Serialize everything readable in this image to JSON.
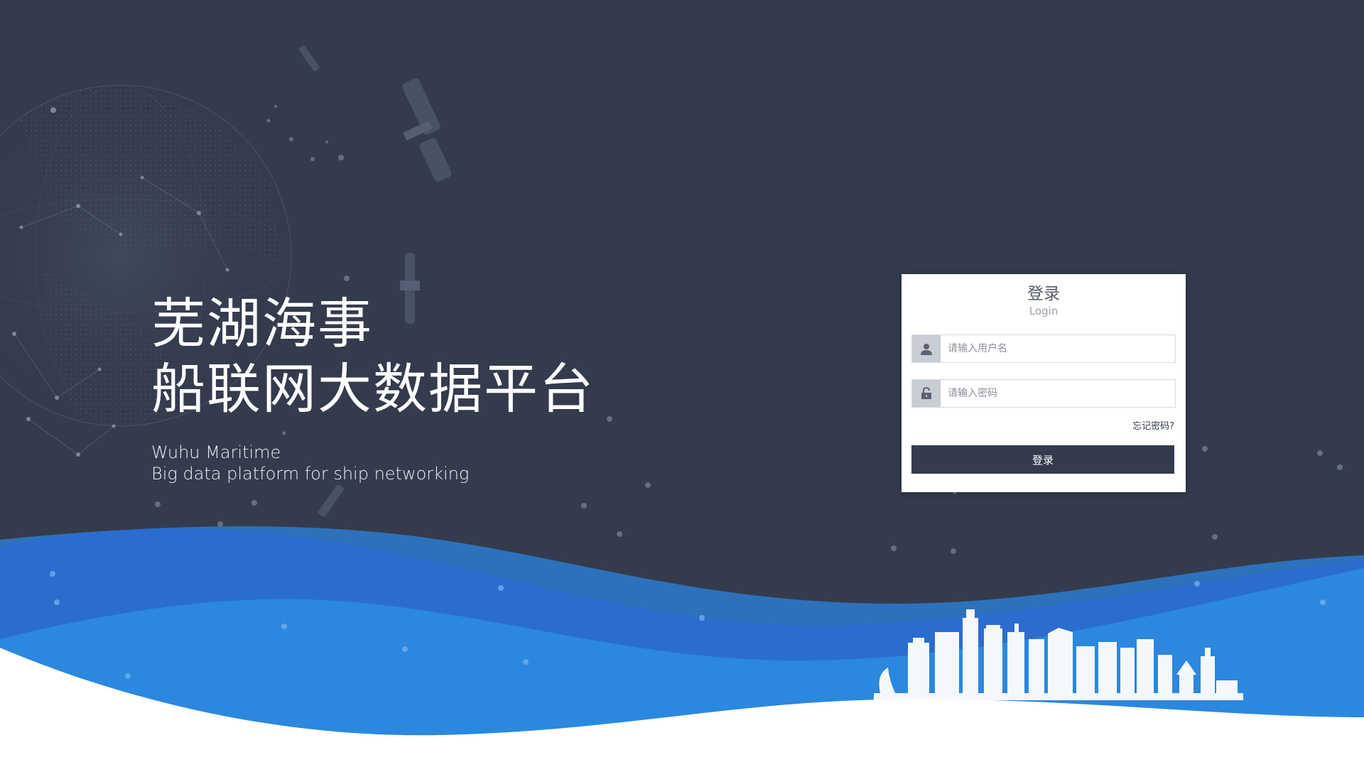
{
  "hero": {
    "title_line1": "芜湖海事",
    "title_line2": "船联网大数据平台",
    "subtitle_line1": "Wuhu Maritime",
    "subtitle_line2": "Big data platform for ship networking"
  },
  "login": {
    "title": "登录",
    "subtitle": "Login",
    "username_placeholder": "请输入用户名",
    "password_placeholder": "请输入密码",
    "forgot_password": "忘记密码?",
    "submit_label": "登录",
    "username_icon": "user-icon",
    "password_icon": "lock-icon"
  },
  "colors": {
    "background": "#343b4d",
    "wave_light": "#2f83e0",
    "wave_dark": "#2a6fd4",
    "button": "#343b4d",
    "card": "#ffffff"
  }
}
